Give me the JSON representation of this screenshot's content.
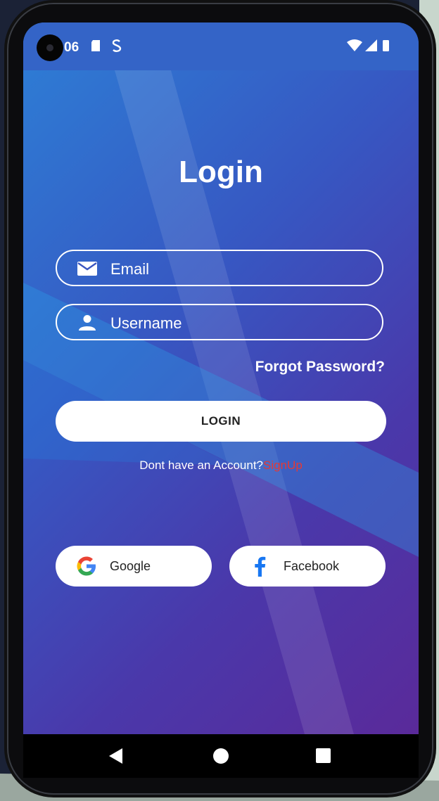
{
  "status_bar": {
    "time": "06"
  },
  "login": {
    "title": "Login",
    "email_placeholder": "Email",
    "username_placeholder": "Username",
    "forgot_password": "Forgot Password?",
    "login_button": "LOGIN",
    "no_account_text": "Dont have an Account?",
    "signup_link": "SignUp"
  },
  "social": {
    "google_label": "Google",
    "facebook_label": "Facebook"
  },
  "icons": {
    "email": "envelope-icon",
    "username": "person-icon",
    "google": "google-g-icon",
    "facebook": "facebook-f-icon"
  },
  "colors": {
    "status_bar": "#3464c7",
    "gradient_start": "#2d7fd6",
    "gradient_end": "#5a2a9a",
    "signup_link": "#e53935",
    "facebook_blue": "#1877f2"
  }
}
